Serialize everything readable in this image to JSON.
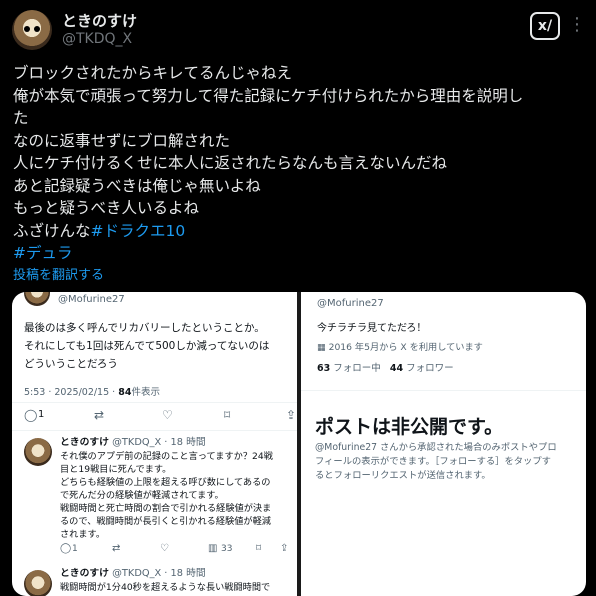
{
  "header": {
    "display_name": "ときのすけ",
    "handle": "@TKDQ_X",
    "grok_label": "x/",
    "more_label": "⋮"
  },
  "tweet": {
    "lines": [
      "ブロックされたからキレてるんじゃねえ",
      "俺が本気で頑張って努力して得た記録にケチ付けられたから理由を説明し",
      "た",
      "なのに返事せずにブロ解された",
      "人にケチ付けるくせに本人に返されたらなんも言えないんだね",
      "あと記録疑うべきは俺じゃ無いよね",
      "もっと疑うべき人いるよね"
    ],
    "last_line_prefix": "ふざけんな",
    "hashtag1": "#ドラクエ10",
    "hashtag2": "#デュラ",
    "translate": "投稿を翻訳する"
  },
  "left_shot": {
    "handle": "@Mofurine27",
    "post_lines": [
      "最後のは多く呼んでリカバリーしたということか。",
      "それにしても1回は死んでて500しか減ってないのは",
      "どういうことだろう"
    ],
    "time": "5:53 · 2025/02/15 · ",
    "views_count": "84",
    "views_label": "件表示",
    "reply_count": "1",
    "reply": {
      "name": "ときのすけ",
      "meta": "@TKDQ_X · 18 時間",
      "lines": [
        "それ僕のアプデ前の記録のこと言ってますか？24戦",
        "目と19戦目に死んでます。",
        "どちらも経験値の上限を超える呼び数にしてあるの",
        "で死んだ分の経験値が軽減されてます。",
        "戦闘時間と死亡時間の割合で引かれる経験値が決ま",
        "るので、戦闘時間が長引くと引かれる経験値が軽減",
        "されます。"
      ],
      "reply_count": "1",
      "views": "33"
    },
    "reply2": {
      "name": "ときのすけ",
      "meta": "@TKDQ_X · 18 時間",
      "line": "戦闘時間が1分40秒を超えるような長い戦闘時間で"
    }
  },
  "right_shot": {
    "handle": "@Mofurine27",
    "bio": "今チラチラ見てただろ！",
    "joined": "2016 年5月から X を利用しています",
    "following_count": "63",
    "following_label": "フォロー中",
    "followers_count": "44",
    "followers_label": "フォロワー",
    "private_title": "ポストは非公開です。",
    "private_desc": [
      "@Mofurine27 さんから承認された場合のみポストやプロ",
      "フィールの表示ができます。［フォローする］をタップす",
      "るとフォローリクエストが送信されます。"
    ]
  },
  "colors": {
    "background": "#000000",
    "text": "#e7e9ea",
    "muted": "#71767b",
    "link": "#1d9bf0"
  }
}
